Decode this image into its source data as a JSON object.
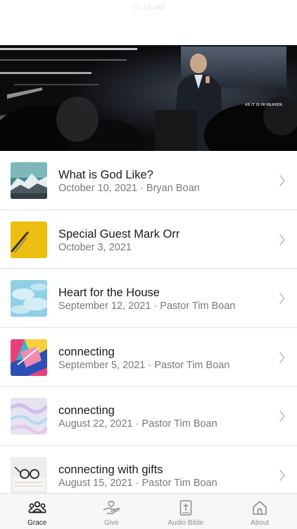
{
  "status_bar": {
    "time": "10:15 AM"
  },
  "hero": {
    "screen_text": "AS IT IS IN HEAVEN."
  },
  "sermons": [
    {
      "title": "What is God Like?",
      "subtitle": "October 10, 2021 · Bryan Boan"
    },
    {
      "title": "Special Guest Mark Orr",
      "subtitle": "October 3, 2021"
    },
    {
      "title": "Heart for the House",
      "subtitle": "September 12, 2021 · Pastor Tim Boan"
    },
    {
      "title": "connecting",
      "subtitle": "September 5, 2021 · Pastor Tim Boan"
    },
    {
      "title": "connecting",
      "subtitle": "August 22, 2021 · Pastor Tim Boan"
    },
    {
      "title": "connecting with gifts",
      "subtitle": "August 15, 2021 · Pastor Tim Boan"
    }
  ],
  "tabbar": {
    "tabs": [
      {
        "label": "Grace",
        "icon": "people-icon",
        "active": true
      },
      {
        "label": "Give",
        "icon": "hand-heart-icon",
        "active": false
      },
      {
        "label": "Audio Bible",
        "icon": "bible-icon",
        "active": false
      },
      {
        "label": "About",
        "icon": "home-icon",
        "active": false
      }
    ]
  },
  "colors": {
    "active_tab": "#1c1c1e",
    "inactive_tab": "#8e8e93",
    "separator": "#e3e3e6"
  }
}
